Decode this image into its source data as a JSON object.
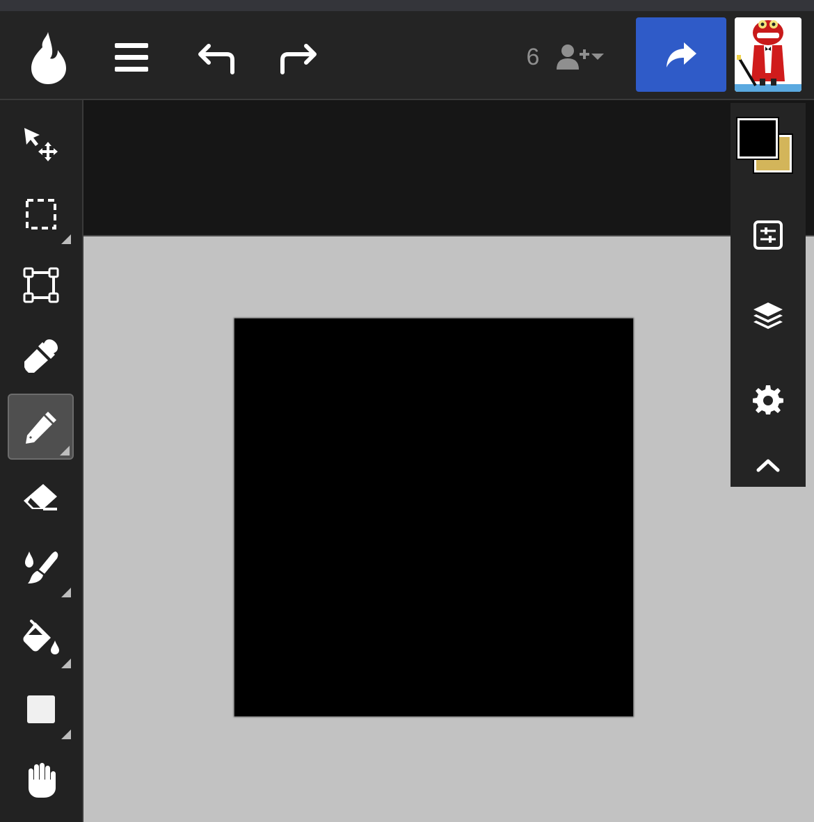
{
  "toolbar": {
    "user_count": "6",
    "colors": {
      "share_button": "#2f5bc8"
    }
  },
  "colors": {
    "primary": "#000000",
    "secondary": "#d3b55a",
    "canvas_background": "#c2c2c2",
    "document_fill": "#000000"
  },
  "icons": {
    "top": [
      "logo-drop-icon",
      "menu-icon",
      "undo-icon",
      "redo-icon",
      "add-user-icon",
      "dropdown-caret-icon",
      "share-icon"
    ],
    "tools": [
      "move-icon",
      "select-icon",
      "transform-icon",
      "eyedropper-icon",
      "pen-icon",
      "eraser-icon",
      "brush-icon",
      "fill-icon",
      "shape-icon",
      "hand-icon"
    ],
    "panels": [
      "adjustments-icon",
      "layers-icon",
      "settings-icon",
      "collapse-icon"
    ]
  },
  "tools": {
    "active": "pen"
  }
}
